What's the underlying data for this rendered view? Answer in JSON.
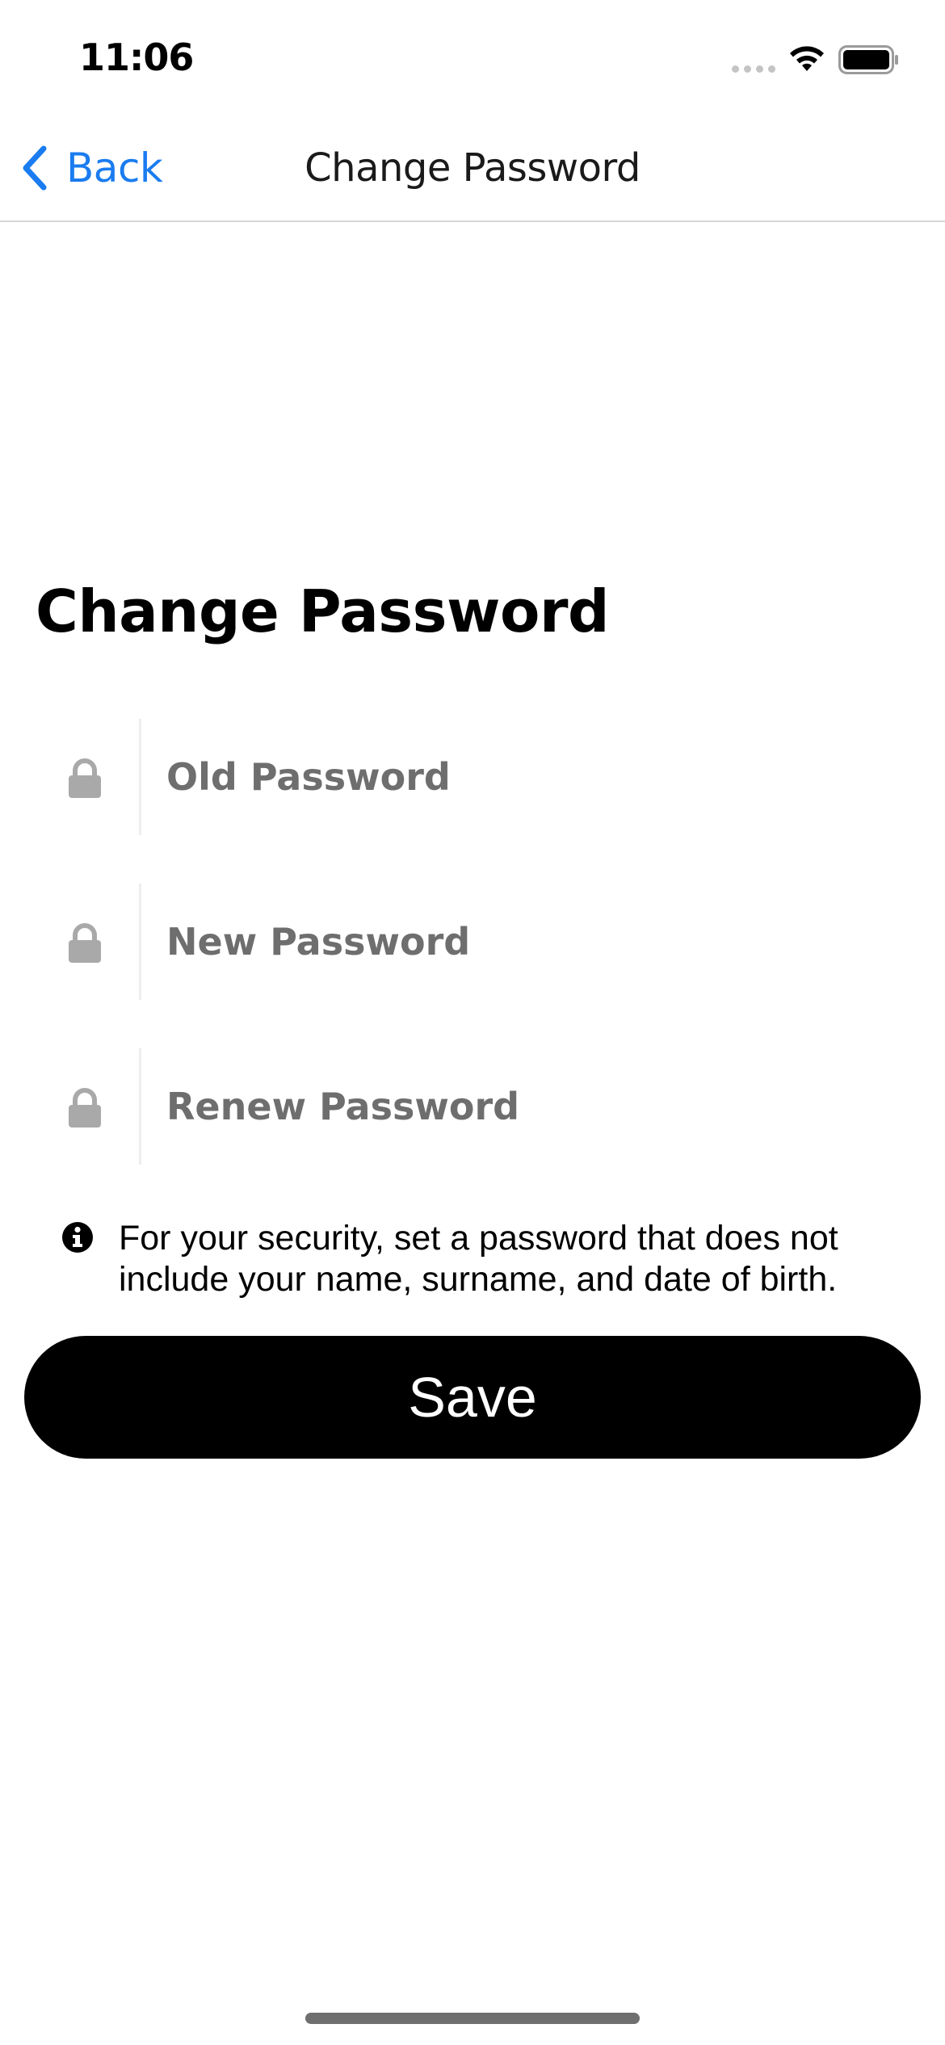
{
  "status_bar": {
    "time": "11:06",
    "icons": [
      "signal-dots-icon",
      "wifi-icon",
      "battery-icon"
    ]
  },
  "nav": {
    "back_label": "Back",
    "title": "Change Password",
    "back_color": "#1a7cf0"
  },
  "page": {
    "heading": "Change Password"
  },
  "fields": [
    {
      "placeholder": "Old Password",
      "value": "",
      "icon": "lock-icon"
    },
    {
      "placeholder": "New Password",
      "value": "",
      "icon": "lock-icon"
    },
    {
      "placeholder": "Renew Password",
      "value": "",
      "icon": "lock-icon"
    }
  ],
  "info": {
    "icon": "info-icon",
    "text": "For your security, set a password that does not include your name, surname, and date of birth."
  },
  "save_button": {
    "label": "Save",
    "background": "#000000",
    "text_color": "#ffffff"
  }
}
